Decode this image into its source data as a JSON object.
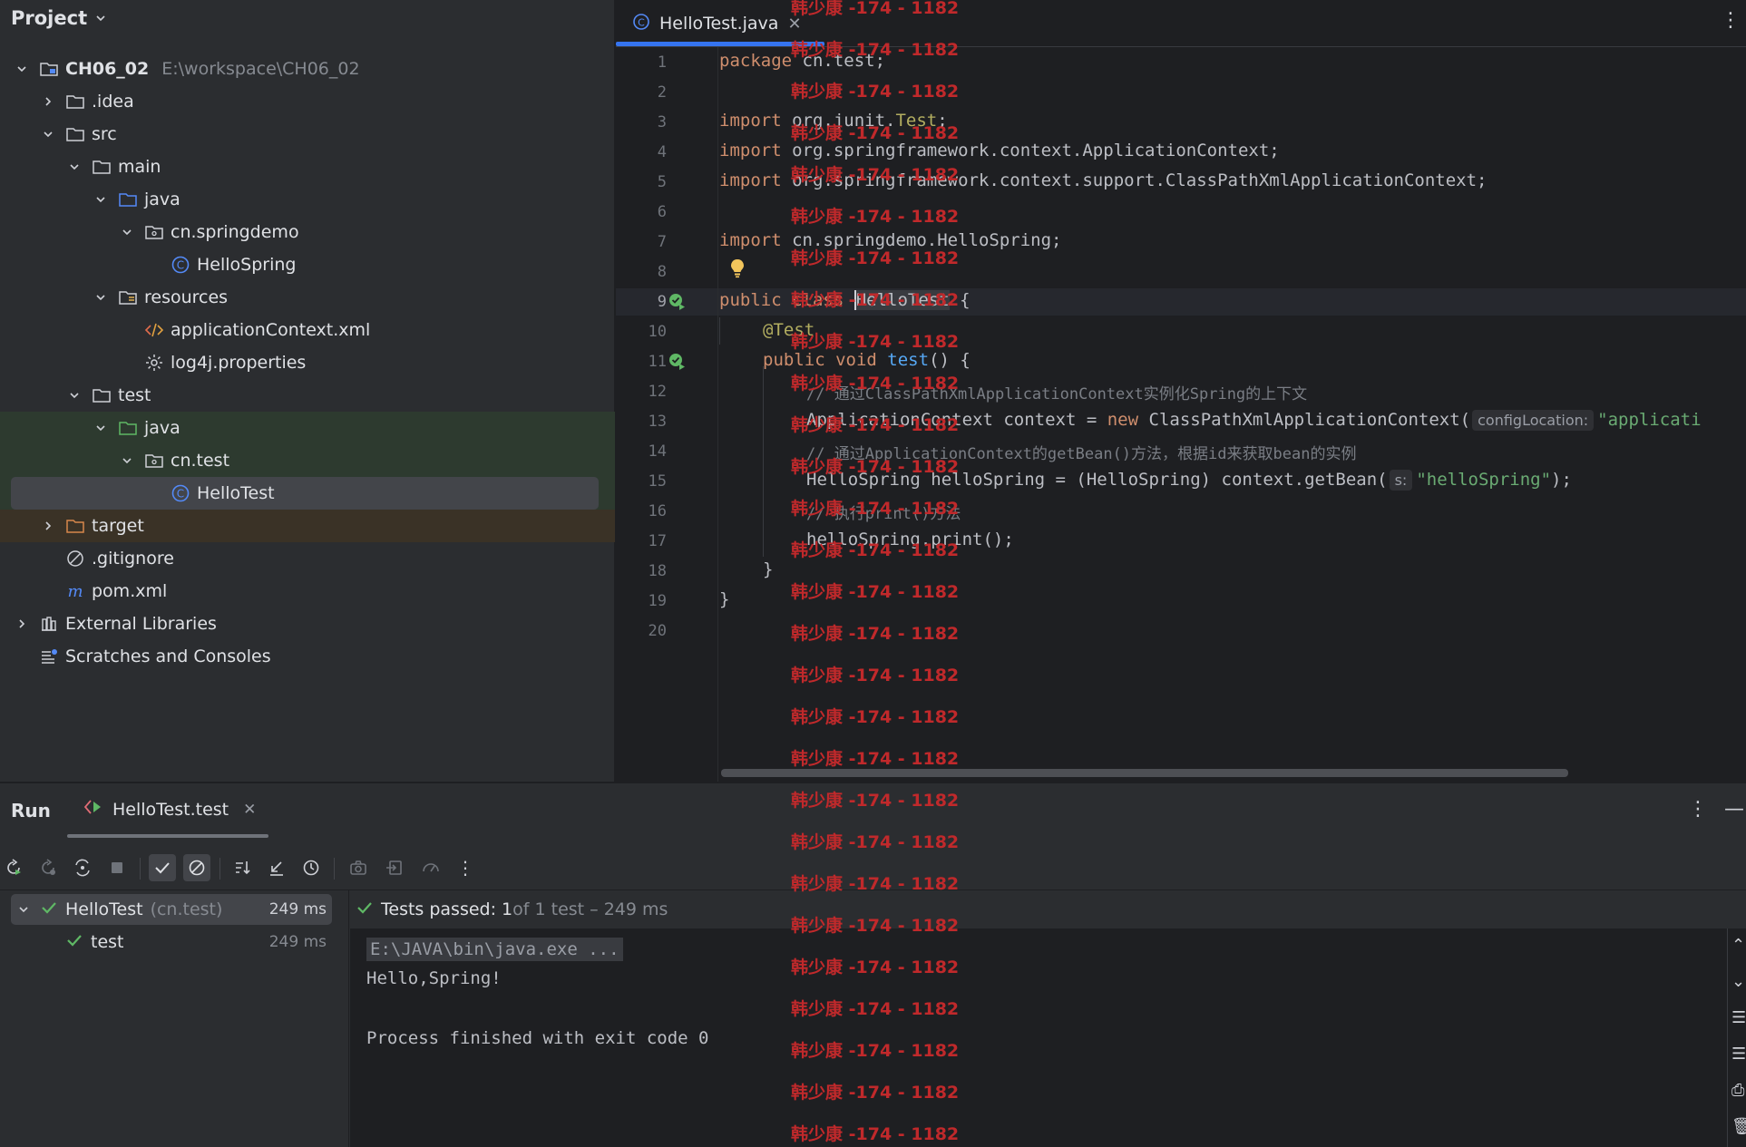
{
  "project": {
    "title": "Project",
    "tree": [
      {
        "label": "CH06_02",
        "path": "E:\\workspace\\CH06_02",
        "icon": "module-folder-icon",
        "bold": true,
        "depth": 0,
        "arrow": "down"
      },
      {
        "label": ".idea",
        "icon": "folder-icon",
        "depth": 1,
        "arrow": "right"
      },
      {
        "label": "src",
        "icon": "folder-icon",
        "depth": 1,
        "arrow": "down"
      },
      {
        "label": "main",
        "icon": "folder-icon",
        "depth": 2,
        "arrow": "down"
      },
      {
        "label": "java",
        "icon": "source-folder-icon",
        "depth": 3,
        "arrow": "down"
      },
      {
        "label": "cn.springdemo",
        "icon": "package-icon",
        "depth": 4,
        "arrow": "down"
      },
      {
        "label": "HelloSpring",
        "icon": "class-icon",
        "depth": 5,
        "arrow": "none"
      },
      {
        "label": "resources",
        "icon": "resources-folder-icon",
        "depth": 3,
        "arrow": "down"
      },
      {
        "label": "applicationContext.xml",
        "icon": "xml-file-icon",
        "depth": 4,
        "arrow": "none"
      },
      {
        "label": "log4j.properties",
        "icon": "properties-file-icon",
        "depth": 4,
        "arrow": "none"
      },
      {
        "label": "test",
        "icon": "folder-icon",
        "depth": 2,
        "arrow": "down"
      },
      {
        "label": "java",
        "icon": "test-source-folder-icon",
        "depth": 3,
        "arrow": "down"
      },
      {
        "label": "cn.test",
        "icon": "package-icon",
        "depth": 4,
        "arrow": "down"
      },
      {
        "label": "HelloTest",
        "icon": "class-icon",
        "depth": 5,
        "arrow": "none",
        "selected": true
      },
      {
        "label": "target",
        "icon": "excluded-folder-icon",
        "depth": 1,
        "arrow": "right"
      },
      {
        "label": ".gitignore",
        "icon": "gitignore-icon",
        "depth": 1,
        "arrow": "none"
      },
      {
        "label": "pom.xml",
        "icon": "maven-icon",
        "depth": 1,
        "arrow": "none"
      },
      {
        "label": "External Libraries",
        "icon": "library-icon",
        "depth": 0,
        "arrow": "right"
      },
      {
        "label": "Scratches and Consoles",
        "icon": "scratches-icon",
        "depth": 0,
        "arrow": "none"
      }
    ]
  },
  "editor": {
    "tab_label": "HelloTest.java",
    "line_numbers": [
      "1",
      "2",
      "3",
      "4",
      "5",
      "6",
      "7",
      "8",
      "9",
      "10",
      "11",
      "12",
      "13",
      "14",
      "15",
      "16",
      "17",
      "18",
      "19",
      "20"
    ],
    "hint_config_location": "configLocation:",
    "hint_s": "s:",
    "code": {
      "l1_kw": "package",
      "l1_rest": " cn.test;",
      "l3_kw": "import",
      "l3_a": " org.junit.",
      "l3_b": "Test",
      "l3_c": ";",
      "l4_kw": "import",
      "l4_rest": " org.springframework.context.ApplicationContext;",
      "l5_kw": "import",
      "l5_rest": " org.springframework.context.support.ClassPathXmlApplicationContext;",
      "l7_kw": "import",
      "l7_rest": " cn.springdemo.HelloSpring;",
      "l9_kw": "public class",
      "l9_sp": " ",
      "l9_name": "HelloTest",
      "l9_rest": " {",
      "l10": "@Test",
      "l11_kw": "public void",
      "l11_sp": " ",
      "l11_fn": "test",
      "l11_rest": "() {",
      "l12": "// 通过ClassPathXmlApplicationContext实例化Spring的上下文",
      "l13_a": "ApplicationContext context = ",
      "l13_kw": "new",
      "l13_b": " ClassPathXmlApplicationContext(",
      "l13_str": "\"applicati",
      "l14": "// 通过ApplicationContext的getBean()方法，根据id来获取bean的实例",
      "l15_a": "HelloSpring helloSpring = (HelloSpring) context.getBean(",
      "l15_str": "\"helloSpring\"",
      "l15_b": ");",
      "l16": "// 执行print()方法",
      "l17": "helloSpring.print();",
      "l18": "}",
      "l19": "}"
    }
  },
  "run": {
    "title": "Run",
    "tab_label": "HelloTest.test",
    "tree": [
      {
        "label": "HelloTest",
        "sub": "(cn.test)",
        "time": "249 ms"
      },
      {
        "label": "test",
        "time": "249 ms"
      }
    ],
    "status_bold": "Tests passed: 1",
    "status_rest": " of 1 test – 249 ms",
    "console": {
      "cmd": "E:\\JAVA\\bin\\java.exe ...",
      "out1": "Hello,Spring!",
      "out2": "Process finished with exit code 0"
    }
  },
  "watermark": "韩少康 -174 - 1182",
  "colors": {
    "accent": "#3574f0",
    "success": "#5fb865",
    "watermark": "#c0292b",
    "keyword": "#cf8e6d",
    "string": "#6aab73"
  }
}
